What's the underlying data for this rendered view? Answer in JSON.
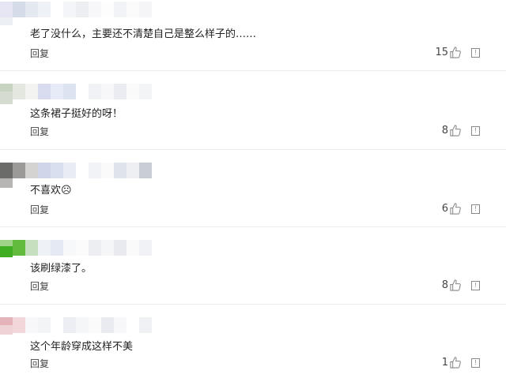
{
  "ui": {
    "reply_label": "回复",
    "report_glyph": "!"
  },
  "comments": [
    {
      "text": "老了没什么，主要还不清楚自己是整么样子的……",
      "likes": "15",
      "avatar_colors": [
        "#e5e5f3",
        "#d5dbe9",
        "#e4e8f0",
        "#eef1f5",
        "#ffffff",
        "#f4f5f8",
        "#eceef2",
        "#f7f7f9",
        "#fdfdfe",
        "#f2f3f6",
        "#fbfbfc",
        "#f5f5f7"
      ]
    },
    {
      "text": "这条裙子挺好的呀！",
      "likes": "8",
      "avatar_colors": [
        "#c9d3c2",
        "#e3e7df",
        "#f3f3f1",
        "#d9dcef",
        "#e7eaf7",
        "#dee3f2",
        "#ffffff",
        "#f1f2f6",
        "#f7f7fa",
        "#eaecf2",
        "#fafafb",
        "#f3f4f6"
      ]
    },
    {
      "text": "不喜欢☹",
      "likes": "6",
      "avatar_colors": [
        "#6b6b69",
        "#9c9a98",
        "#d5d3d1",
        "#cfd6ea",
        "#d9deef",
        "#eaecf3",
        "#ffffff",
        "#f2f3f6",
        "#fafafb",
        "#dfe3ec",
        "#edeff3",
        "#c8ccd3"
      ]
    },
    {
      "text": "该刷绿漆了。",
      "likes": "8",
      "avatar_colors": [
        "#9fd38a",
        "#63bb3e",
        "#c6dfbf",
        "#eef2f6",
        "#e5e9f3",
        "#f7f8fa",
        "#fbfbfc",
        "#eceef2",
        "#f5f6f8",
        "#e8eaef",
        "#fafafb",
        "#f1f2f5"
      ]
    },
    {
      "text": "这个年龄穿成这样不美",
      "likes": "1",
      "avatar_colors": [
        "#e5b4bb",
        "#f1d6da",
        "#f7f7f9",
        "#f3f4f6",
        "#ffffff",
        "#eceef3",
        "#f5f6f8",
        "#fafafb",
        "#e9ebf0",
        "#f7f7f9",
        "#ffffff",
        "#eef0f3"
      ]
    }
  ]
}
